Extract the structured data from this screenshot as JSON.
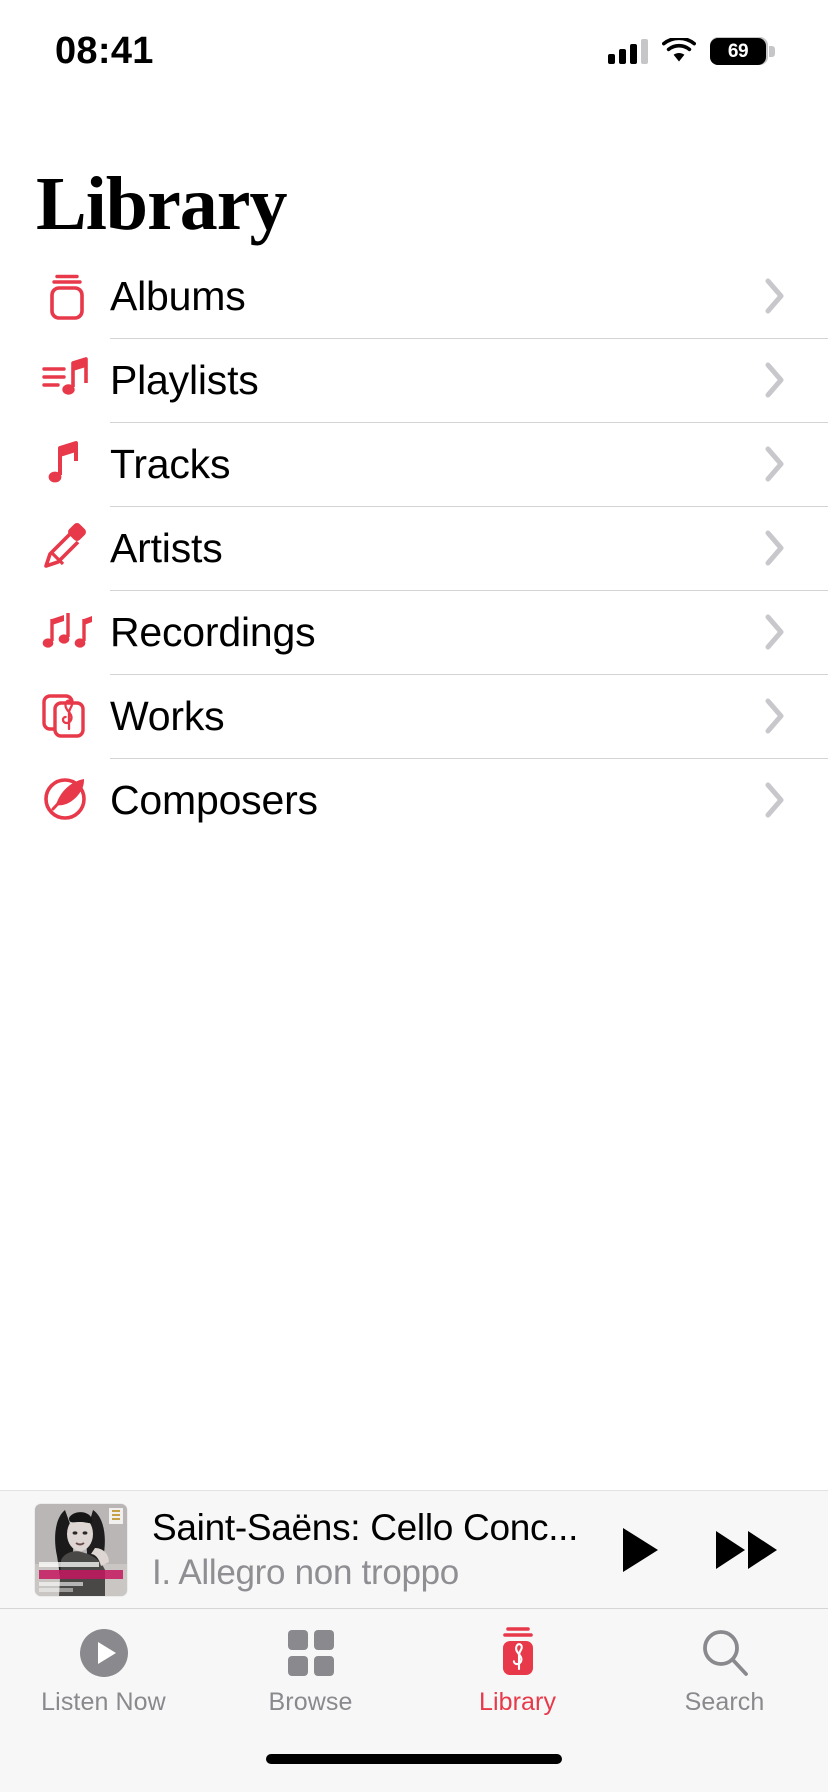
{
  "status_bar": {
    "time": "08:41",
    "battery_percent": "69",
    "signal_icon": "cellular-bars-icon",
    "wifi_icon": "wifi-icon",
    "battery_icon": "battery-icon"
  },
  "header": {
    "title": "Library"
  },
  "library_items": [
    {
      "label": "Albums",
      "icon": "albums-stack-icon",
      "chevron": "chevron-right-icon"
    },
    {
      "label": "Playlists",
      "icon": "playlist-note-icon",
      "chevron": "chevron-right-icon"
    },
    {
      "label": "Tracks",
      "icon": "music-note-icon",
      "chevron": "chevron-right-icon"
    },
    {
      "label": "Artists",
      "icon": "microphone-icon",
      "chevron": "chevron-right-icon"
    },
    {
      "label": "Recordings",
      "icon": "triple-note-icon",
      "chevron": "chevron-right-icon"
    },
    {
      "label": "Works",
      "icon": "cards-treble-clef-icon",
      "chevron": "chevron-right-icon"
    },
    {
      "label": "Composers",
      "icon": "quill-circle-icon",
      "chevron": "chevron-right-icon"
    }
  ],
  "now_playing": {
    "title": "Saint-Saëns: Cello Conc...",
    "subtitle": "I. Allegro non troppo",
    "artwork_name": "album-artwork",
    "play_button_icon": "play-icon",
    "next_button_icon": "fast-forward-icon"
  },
  "tab_bar": {
    "tabs": [
      {
        "label": "Listen Now",
        "icon": "play-circle-icon",
        "active": false
      },
      {
        "label": "Browse",
        "icon": "grid-squares-icon",
        "active": false
      },
      {
        "label": "Library",
        "icon": "library-stack-icon",
        "active": true
      },
      {
        "label": "Search",
        "icon": "search-icon",
        "active": false
      }
    ]
  },
  "colors": {
    "accent_red": "#e8394a",
    "inactive_gray": "#8a8a8e",
    "separator": "#d4d4d6",
    "chevron_gray": "#c7c7cc",
    "bar_background": "#f7f7f7",
    "secondary_text": "#8e8e93"
  }
}
